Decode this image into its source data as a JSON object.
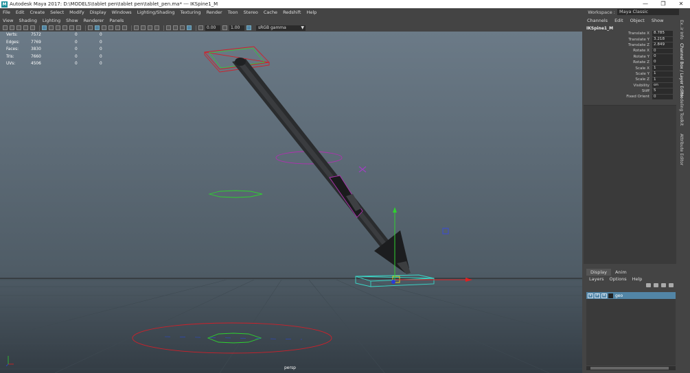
{
  "window": {
    "app_icon": "M",
    "title": "Autodesk Maya 2017: D:\\MODELS\\tablet pen\\tablet pen\\tablet_pen.ma*   ---   IKSpine1_M",
    "minimize": "—",
    "maximize": "❐",
    "close": "✕"
  },
  "menubar": [
    "File",
    "Edit",
    "Create",
    "Select",
    "Modify",
    "Display",
    "Windows",
    "Lighting/Shading",
    "Texturing",
    "Render",
    "Toon",
    "Stereo",
    "Cache",
    "Redshift",
    "Help"
  ],
  "workspace": {
    "label": "Workspace :",
    "value": "Maya Classic"
  },
  "panel_menu": [
    "View",
    "Shading",
    "Lighting",
    "Show",
    "Renderer",
    "Panels"
  ],
  "toolbar": {
    "field1": "0.00",
    "field2": "1.00",
    "color_space": "sRGB gamma"
  },
  "hud": [
    {
      "key": "Verts:",
      "v1": "7572",
      "v2": "0",
      "v3": "0"
    },
    {
      "key": "Edges:",
      "v1": "7769",
      "v2": "0",
      "v3": "0"
    },
    {
      "key": "Faces:",
      "v1": "3830",
      "v2": "0",
      "v3": "0"
    },
    {
      "key": "Tris:",
      "v1": "7660",
      "v2": "0",
      "v3": "0"
    },
    {
      "key": "UVs:",
      "v1": "4506",
      "v2": "0",
      "v3": "0"
    }
  ],
  "viewport_label": "persp",
  "channel_box": {
    "menu": [
      "Channels",
      "Edit",
      "Object",
      "Show"
    ],
    "object": "IKSpine1_M",
    "attrs": [
      {
        "name": "Translate X",
        "value": "8.785"
      },
      {
        "name": "Translate Y",
        "value": "3.218"
      },
      {
        "name": "Translate Z",
        "value": "2.849"
      },
      {
        "name": "Rotate X",
        "value": "0"
      },
      {
        "name": "Rotate Y",
        "value": "0"
      },
      {
        "name": "Rotate Z",
        "value": "0"
      },
      {
        "name": "Scale X",
        "value": "1"
      },
      {
        "name": "Scale Y",
        "value": "1"
      },
      {
        "name": "Scale Z",
        "value": "1"
      },
      {
        "name": "Visibility",
        "value": "on"
      },
      {
        "name": "Stiff",
        "value": "5"
      },
      {
        "name": "Fixed Orient",
        "value": "0"
      }
    ]
  },
  "layer_editor": {
    "tabs": [
      "Display",
      "Anim"
    ],
    "menu": [
      "Layers",
      "Options",
      "Help"
    ],
    "layer": {
      "v": "V",
      "p": "P",
      "r": "R",
      "name": "geo"
    }
  },
  "side_tabs": [
    "Channel Box / Layer Editor",
    "Modeling Toolkit",
    "Attribute Editor"
  ],
  "side_tabs_top": "Ex..ir Info"
}
